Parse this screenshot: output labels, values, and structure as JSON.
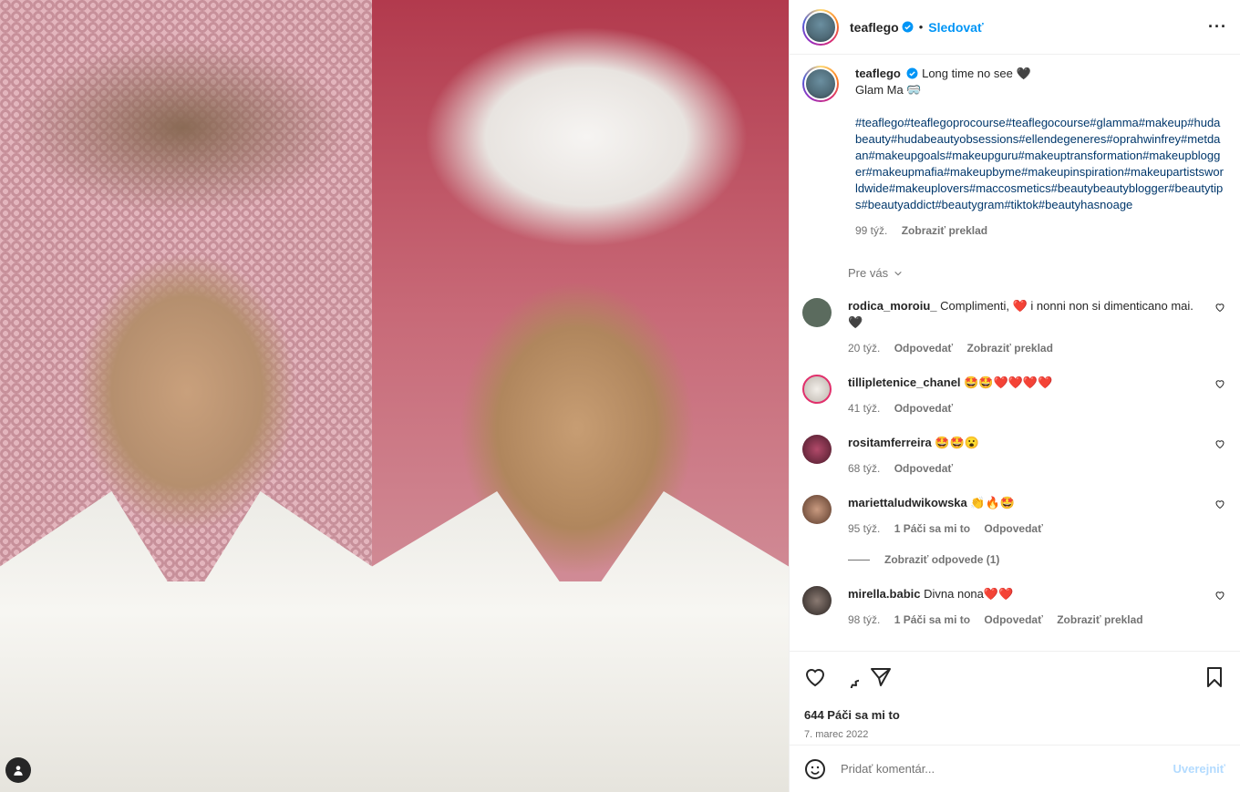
{
  "header": {
    "username": "teaflego",
    "follow_label": "Sledovať",
    "more_icon": "more-options-icon"
  },
  "caption": {
    "username": "teaflego",
    "line1": "Long time no see 🖤",
    "line2": "Glam Ma 🥽",
    "hashtags": "#teaflego#teaflegoprocourse#teaflegocourse#glamma#makeup#hudabeauty#hudabeautyobsessions#ellendegeneres#oprahwinfrey#metdaan#makeupgoals#makeupguru#makeuptransformation#makeupblogger#makeupmafia#makeupbyme#makeupinspiration#makeupartistsworldwide#makeuplovers#maccosmetics#beautybeautyblogger#beautytips#beautyaddict#beautygram#tiktok#beautyhasnoage",
    "age": "99 týž.",
    "translate": "Zobraziť preklad"
  },
  "for_you_label": "Pre vás",
  "comments": [
    {
      "user": "rodica_moroiu_",
      "text": "Complimenti, ❤️ i nonni non si dimenticano mai. 🖤",
      "age": "20 týž.",
      "likes": "",
      "reply": "Odpovedať",
      "translate": "Zobraziť preklad",
      "avatar_color": "#5b6b5e"
    },
    {
      "user": "tillipletenice_chanel",
      "text": "🤩🤩❤️❤️❤️❤️",
      "age": "41 týž.",
      "likes": "",
      "reply": "Odpovedať",
      "translate": "",
      "avatar_color": "#d8d4d0"
    },
    {
      "user": "rositamferreira",
      "text": "🤩🤩😮",
      "age": "68 týž.",
      "likes": "",
      "reply": "Odpovedať",
      "translate": "",
      "avatar_color": "#6a2a3a"
    },
    {
      "user": "mariettaludwikowska",
      "text": "👏🔥🤩",
      "age": "95 týž.",
      "likes": "1 Páči sa mi to",
      "reply": "Odpovedať",
      "translate": "",
      "avatar_color": "#8a6a5a"
    },
    {
      "user": "mirella.babic",
      "text": "Divna nona❤️❤️",
      "age": "98 týž.",
      "likes": "1 Páči sa mi to",
      "reply": "Odpovedať",
      "translate": "Zobraziť preklad",
      "avatar_color": "#3a3432"
    }
  ],
  "view_replies": "Zobraziť odpovede (1)",
  "stats": {
    "likes": "644 Páči sa mi to",
    "date": "7. marec 2022"
  },
  "composer": {
    "placeholder": "Pridať komentár...",
    "post_label": "Uverejniť"
  },
  "colors": {
    "accent": "#0095f6",
    "hashtag": "#00376b",
    "muted": "#737373",
    "post_disabled": "#b3dbff"
  }
}
